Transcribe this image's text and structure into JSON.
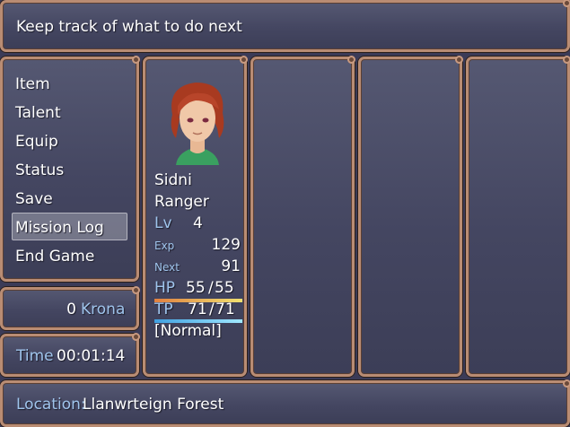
{
  "help": {
    "text": "Keep track of what to do next"
  },
  "menu": {
    "items": [
      "Item",
      "Talent",
      "Equip",
      "Status",
      "Save",
      "Mission Log",
      "End Game"
    ],
    "selected_index": 5
  },
  "gold": {
    "amount": "0",
    "unit": "Krona"
  },
  "time": {
    "label": "Time",
    "value": "00:01:14"
  },
  "location": {
    "label": "Location:",
    "value": "Llanwrteign Forest"
  },
  "actor": {
    "name": "Sidni",
    "class": "Ranger",
    "lv_label": "Lv",
    "level": "4",
    "exp_label": "Exp",
    "exp": "129",
    "next_label": "Next",
    "next": "91",
    "hp_label": "HP",
    "hp": "55",
    "hp_max": "55",
    "hp_rate": 1.0,
    "tp_label": "TP",
    "tp": "71",
    "tp_max": "71",
    "tp_rate": 1.0,
    "state": "[Normal]"
  },
  "colors": {
    "frame": "#b98c73",
    "system_text": "#9fc4ec",
    "hp_gauge_start": "#e08040",
    "hp_gauge_end": "#f0e070",
    "tp_gauge_start": "#40a0e0",
    "tp_gauge_end": "#a0e8ff"
  }
}
